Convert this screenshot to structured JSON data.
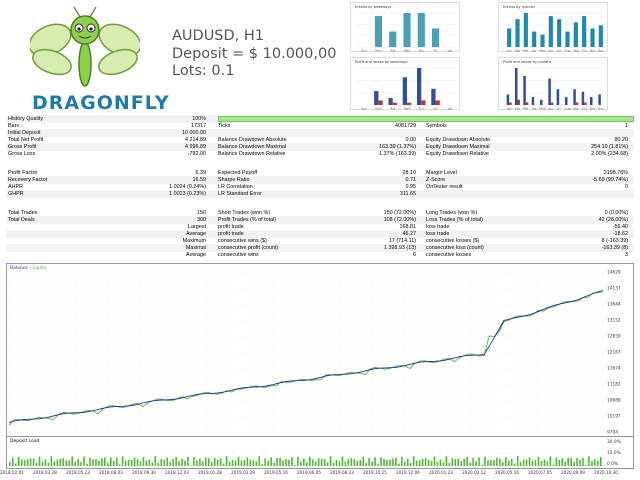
{
  "brand": {
    "name": "DRAGONFLY"
  },
  "header": {
    "symbol": "AUDUSD, H1",
    "deposit": "Deposit = $ 10.000,00",
    "lots": "Lots: 0.1"
  },
  "mini_charts": [
    {
      "title": "Entries by weekdays",
      "categories": [
        "Sun",
        "Mon",
        "Tue",
        "Wed",
        "Thu",
        "Fri",
        "Sat"
      ],
      "values": [
        0,
        10,
        5,
        11,
        11,
        6,
        0
      ],
      "color": "#4ba0b5"
    },
    {
      "title": "Entries by months",
      "categories": [
        "Jan",
        "Feb",
        "Mar",
        "Apr",
        "May",
        "Jun",
        "Jul",
        "Aug",
        "Sep",
        "Oct",
        "Nov",
        "Dec"
      ],
      "values": [
        6,
        9,
        11,
        5,
        4,
        10,
        9,
        5,
        8,
        10,
        6,
        7
      ],
      "color": "#1e8aa8"
    },
    {
      "title": "Profit and losses by weekdays",
      "categories": [
        "Sun",
        "Mon",
        "Tue",
        "Wed",
        "Thu",
        "Fri",
        "Sat"
      ],
      "values": [
        0,
        6,
        3,
        12,
        16,
        7,
        0
      ],
      "losses": [
        0,
        2,
        1,
        1,
        2,
        2,
        0
      ],
      "color": "#2e4fa0"
    },
    {
      "title": "Profit and losses by months",
      "categories": [
        "Jan",
        "Feb",
        "Mar",
        "Apr",
        "May",
        "Jun",
        "Jul",
        "Aug",
        "Sep",
        "Oct",
        "Nov",
        "Dec"
      ],
      "values": [
        4,
        14,
        11,
        3,
        2,
        10,
        6,
        3,
        6,
        5,
        3,
        4
      ],
      "losses": [
        1,
        2,
        1,
        0,
        0,
        1,
        0,
        0,
        1,
        1,
        0,
        0
      ],
      "color": "#2e4fa0"
    }
  ],
  "stats": {
    "r0": {
      "a": "History Quality",
      "b": "100%"
    },
    "r1": {
      "a": "Bars",
      "b": "17317",
      "c": "Ticks",
      "d": "4081729",
      "e": "Symbols",
      "f": "1"
    },
    "r2": {
      "a": "Initial Deposit",
      "b": "10 000.00"
    },
    "r3": {
      "a": "Total Net Profit",
      "b": "4 214.89",
      "c": "Balance Drawdown Absolute",
      "d": "0.00",
      "e": "Equity Drawdown Absolute",
      "f": "80.20"
    },
    "r4": {
      "a": "Gross Profit",
      "b": "4 996.89",
      "c": "Balance Drawdown Maximal",
      "d": "163.39 (1.37%)",
      "e": "Equity Drawdown Maximal",
      "f": "254.10 (1.81%)"
    },
    "r5": {
      "a": "Gross Loss",
      "b": "-782.00",
      "c": "Balance Drawdown Relative",
      "d": "1.37% (163.39)",
      "e": "Equity Drawdown Relative",
      "f": "2.00% (234.68)"
    },
    "r6": {
      "a": "Profit Factor",
      "b": "6.39",
      "c": "Expected Payoff",
      "d": "28.10",
      "e": "Margin Level",
      "f": "2198.76%"
    },
    "r7": {
      "a": "Recovery Factor",
      "b": "16.59",
      "c": "Sharpe Ratio",
      "d": "0.71",
      "e": "Z-Score",
      "f": "-5.69 (99.74%)"
    },
    "r8": {
      "a": "AHPR",
      "b": "1.0024 (0.24%)",
      "c": "LR Correlation",
      "d": "0.95",
      "e": "OnTester result",
      "f": "0"
    },
    "r9": {
      "a": "GHPR",
      "b": "1.0023 (0.23%)",
      "c": "LR Standard Error",
      "d": "311.65"
    },
    "r10": {
      "a": "Total Trades",
      "b": "150",
      "c": "Short Trades (won %)",
      "d": "150 (72.00%)",
      "e": "Long Trades (won %)",
      "f": "0 (0.00%)"
    },
    "r11": {
      "a": "Total Deals",
      "b": "300",
      "c": "Profit Trades (% of total)",
      "d": "108 (72.00%)",
      "e": "Loss Trades (% of total)",
      "f": "42 (28.00%)"
    },
    "r12": {
      "b": "Largest",
      "c": "profit trade",
      "d": "168.81",
      "e": "loss trade",
      "f": "-56.40"
    },
    "r13": {
      "b": "Average",
      "c": "profit trade",
      "d": "46.27",
      "e": "loss trade",
      "f": "-18.62"
    },
    "r14": {
      "b": "Maximum",
      "c": "consecutive wins ($)",
      "d": "17 (714.11)",
      "e": "consecutive losses ($)",
      "f": "8 (-163.39)"
    },
    "r15": {
      "b": "Maximal",
      "c": "consecutive profit (count)",
      "d": "1 398.93 (13)",
      "e": "consecutive loss (count)",
      "f": "-163.39 (8)"
    },
    "r16": {
      "b": "Average",
      "c": "consecutive wins",
      "d": "6",
      "e": "consecutive losses",
      "f": "3"
    }
  },
  "balance_chart": {
    "legend_balance": "Balance",
    "legend_equity": "Equity",
    "balance_color": "#1f2f9f",
    "equity_color": "#4cbb2e",
    "y_ticks": [
      "14629",
      "14137",
      "13644",
      "13152",
      "12659",
      "12167",
      "11674",
      "11182",
      "10689",
      "10197",
      "9704"
    ],
    "x_ticks": [
      "2018.02.01",
      "2018.03.28",
      "2018.05.23",
      "2018.08.03",
      "2018.09.30",
      "2018.12.03",
      "2019.01.28",
      "2019.03.29",
      "2019.05.16",
      "2019.06.05",
      "2019.08.23",
      "2019.10.25",
      "2019.12.06",
      "2020.01.23",
      "2020.03.12",
      "2020.05.16",
      "2020.07.05",
      "2020.09.09",
      "2020.10.30"
    ]
  },
  "deposit_load": {
    "label": "Deposit Load",
    "y_ticks": [
      "30.0%",
      "15.0%",
      "0.0%"
    ]
  }
}
